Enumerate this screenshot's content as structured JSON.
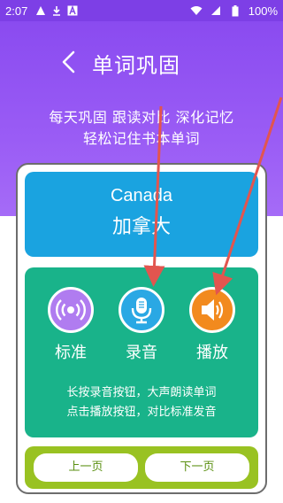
{
  "status_bar": {
    "time": "2:07",
    "battery": "100%",
    "icons": [
      "warning-icon",
      "download-icon",
      "a-icon",
      "wifi-icon",
      "signal-icon",
      "battery-icon"
    ]
  },
  "header": {
    "title": "单词巩固",
    "back_icon": "chevron-left-icon"
  },
  "subtitle": {
    "line1": "每天巩固 跟读对比 深化记忆",
    "line2": "轻松记住书本单词"
  },
  "word": {
    "english": "Canada",
    "chinese": "加拿大"
  },
  "actions": [
    {
      "label": "标准",
      "icon": "standard-audio-icon",
      "color": "#b07cf0"
    },
    {
      "label": "录音",
      "icon": "microphone-icon",
      "color": "#2aa8e4"
    },
    {
      "label": "播放",
      "icon": "speaker-icon",
      "color": "#f28a1e"
    }
  ],
  "hints": {
    "line1": "长按录音按钮，大声朗读单词",
    "line2": "点击播放按钮，对比标准发音"
  },
  "nav": {
    "prev": "上一页",
    "next": "下一页"
  },
  "colors": {
    "header": "#8a4bf0",
    "word_box": "#1aa3e0",
    "action_box": "#19b38a",
    "nav_box": "#99c222",
    "annotation_arrow": "#e2554f"
  }
}
